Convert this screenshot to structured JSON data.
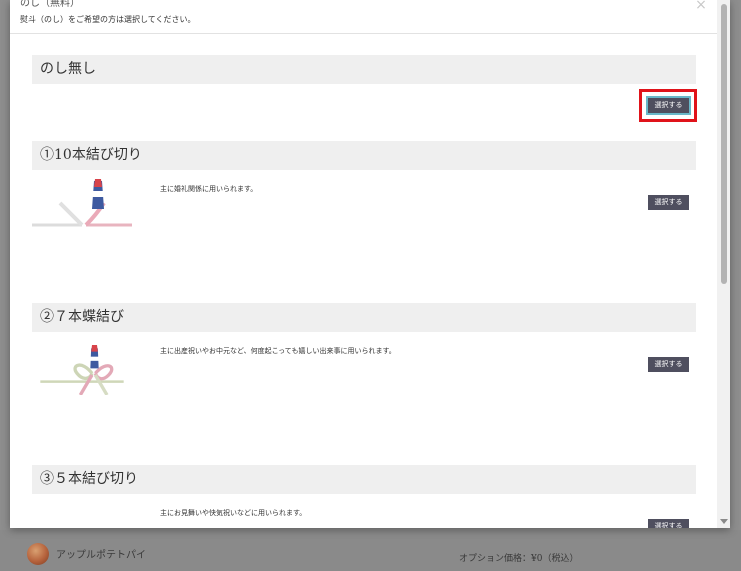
{
  "background": {
    "product_name": "アップルポテトパイ",
    "option_price": "オプション価格：¥0（税込）"
  },
  "modal": {
    "title": "のし（無料）",
    "subtitle": "熨斗（のし）をご希望の方は選択してください。",
    "close_icon": "×"
  },
  "options": [
    {
      "title": "のし無し",
      "description": "",
      "button_label": "選択する"
    },
    {
      "title": "①10本結び切り",
      "description": "主に婚礼関係に用いられます。",
      "button_label": "選択する"
    },
    {
      "title": "②７本蝶結び",
      "description": "主に出産祝いやお中元など、何度起こっても嬉しい出来事に用いられます。",
      "button_label": "選択する"
    },
    {
      "title": "③５本結び切り",
      "description": "主にお見舞いや快気祝いなどに用いられます。",
      "button_label": "選択する"
    }
  ],
  "colors": {
    "highlight": "#e0131a",
    "button": "#4f4f5f",
    "section_bar": "#efefef"
  }
}
